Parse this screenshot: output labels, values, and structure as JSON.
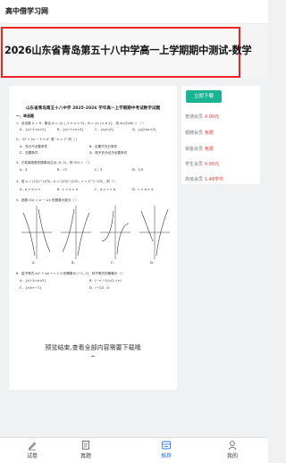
{
  "header": {
    "site_name": "高中借学习网"
  },
  "page": {
    "title": "2026山东省青岛第五十八中学高一上学期期中测试-数学"
  },
  "document": {
    "title": "山东省青岛第五十八中学 2025-2026 学年高一上学期期中考试数学试题",
    "section": "一、单选题",
    "questions": [
      "1．设全集 U = R，集合 A = {x | -1 < x < 3}，B = {x | x ≥ 2}，则 A∩(∁uB) = （    ）",
      "2．“x² + 2x − 3 < 0” 是 “x < 1” 的（    ）",
      "3．已知幂函数的图象经过点 (4, 2)，则 f(9) = （    ）",
      "4．若 a = (1/2)^(1/3)，b = (1/3)^(1/2)，c = 2^(−1/2)，则（    ）",
      "5．函数 f(x) = x − 1/x 的图象大致为（    ）",
      "6．若不等式 ax² + bx + c > 0 的解集为 (−1, 2)，则不等式的解集为（    ）"
    ],
    "q1_options": [
      "A．{x|−1<x<2}",
      "B．{x|−1<x<3}",
      "C．{x|x<2}",
      "D．{x|2≤x<3}"
    ],
    "q2_options": [
      "A．充分不必要条件",
      "B．必要不充分条件",
      "C．充要条件",
      "D．既不充分也不必要条件"
    ],
    "q3_options": [
      "A．3",
      "B．√3",
      "C．9",
      "D．1/3"
    ],
    "q4_options": [
      "A．a > b > c",
      "B．c > a > b",
      "C．a > c > b",
      "D．c > b > a"
    ],
    "q6_options": [
      "A．{x|−1<x<2}",
      "B．(−∞,−1)∪(2,+∞)",
      "C．{x|x<−1}",
      "D．(−1/2, 1)"
    ],
    "graph_labels": [
      "A．",
      "B．",
      "C．",
      "D．"
    ],
    "more_text": "预览结束,查看全部内容需要下载哦~"
  },
  "sidebar": {
    "download_label": "立即下载",
    "rows": [
      {
        "label": "普通会员",
        "value": "4.00元"
      },
      {
        "label": "银牌会员",
        "value": "免费"
      },
      {
        "label": "铂金会员",
        "value": "免费"
      },
      {
        "label": "学生会员",
        "value": "0.00元"
      },
      {
        "label": "高级会员",
        "value": "1.40学币"
      }
    ]
  },
  "tabbar": {
    "tabs": [
      {
        "label": "试卷",
        "icon": "pencil-icon",
        "active": false
      },
      {
        "label": "真题",
        "icon": "document-icon",
        "active": false
      },
      {
        "label": "推荐",
        "icon": "recommend-icon",
        "active": true
      },
      {
        "label": "我的",
        "icon": "person-icon",
        "active": false
      }
    ]
  },
  "colors": {
    "accent": "#1ab394",
    "highlight": "#e22222",
    "tab_active": "#2979ff",
    "price": "#e33333"
  }
}
